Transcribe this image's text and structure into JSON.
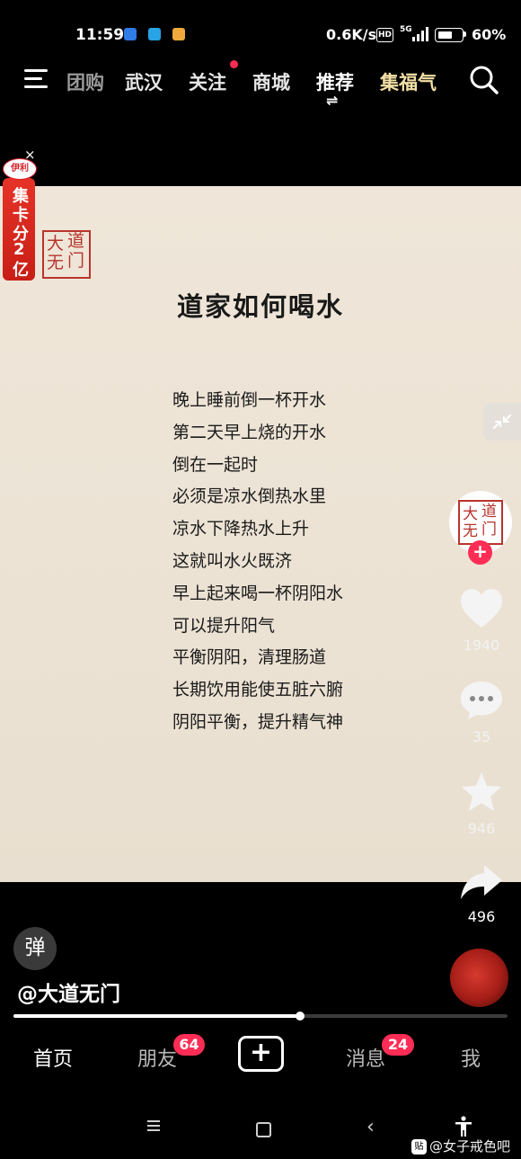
{
  "status_bar": {
    "time": "11:59",
    "net_speed": "0.6K/s",
    "hd_label": "HD",
    "network": "5G",
    "battery": "60%"
  },
  "top_nav": {
    "tabs": [
      "团购",
      "武汉",
      "关注",
      "商城",
      "推荐",
      "集福气"
    ],
    "active_tab": "推荐",
    "recommend_switch": "⇌"
  },
  "ad": {
    "close": "×",
    "logo": "伊利",
    "text_lines": [
      "集",
      "卡",
      "分",
      "2",
      "亿"
    ]
  },
  "video": {
    "seal_chars": [
      "大",
      "道",
      "无",
      "门"
    ],
    "title": "道家如何喝水",
    "lines": [
      "晚上睡前倒一杯开水",
      "第二天早上烧的开水",
      "倒在一起时",
      "必须是凉水倒热水里",
      "凉水下降热水上升",
      "这就叫水火既济",
      "早上起来喝一杯阴阳水",
      "可以提升阳气",
      "平衡阴阳，清理肠道",
      "长期饮用能使五脏六腑",
      "阴阳平衡，提升精气神"
    ]
  },
  "side_rail": {
    "follow_plus": "+",
    "likes": "1940",
    "comments": "35",
    "favorites": "946",
    "shares": "496"
  },
  "info": {
    "danmu": "弹",
    "author_handle": "@大道无门",
    "progress": 0.58
  },
  "bottom_tabs": {
    "home": "首页",
    "friends": "朋友",
    "friends_badge": "64",
    "publish": "+",
    "messages": "消息",
    "messages_badge": "24",
    "me": "我"
  },
  "watermark": {
    "icon": "贴",
    "text": "@女子戒色吧"
  },
  "colors": {
    "accent_red": "#ff2d55",
    "seal_red": "#b8342c",
    "paper": "#ece3d5",
    "gold_tab": "#f3e0a6"
  }
}
